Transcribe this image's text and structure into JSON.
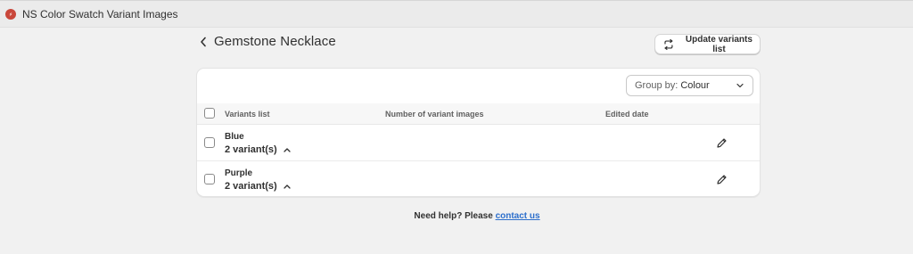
{
  "app": {
    "title": "NS Color Swatch Variant Images",
    "icon": "app-logo-icon",
    "accent": "#c9473a"
  },
  "header": {
    "title": "Gemstone Necklace",
    "back_icon": "chevron-left-icon",
    "update_label": "Update variants list",
    "update_icon": "refresh-icon"
  },
  "group_by": {
    "label": "Group by:",
    "value": "Colour"
  },
  "table": {
    "columns": [
      "Variants list",
      "Number of variant images",
      "Edited date"
    ],
    "rows": [
      {
        "name": "Blue",
        "count": "2 variant(s)"
      },
      {
        "name": "Purple",
        "count": "2 variant(s)"
      }
    ]
  },
  "help": {
    "text": "Need help? Please ",
    "link": "contact us",
    "link_color": "#2c6ecb"
  }
}
